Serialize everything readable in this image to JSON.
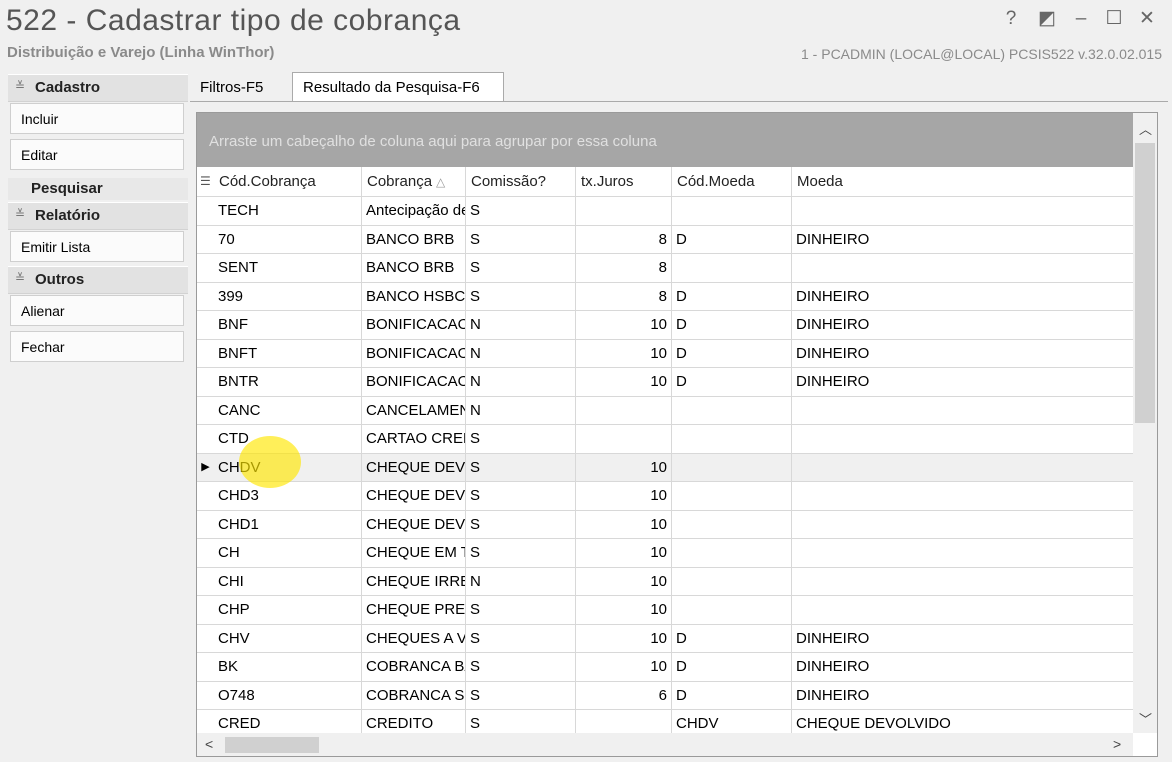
{
  "window": {
    "title": "522 - Cadastrar tipo de cobrança",
    "subtitle": "Distribuição e Varejo (Linha WinThor)",
    "session_info": "1 - PCADMIN (LOCAL@LOCAL)   PCSIS522  v.32.0.02.015",
    "controls": {
      "help": "?",
      "skin": "◩",
      "minimize": "–",
      "maximize": "☐",
      "close": "✕"
    }
  },
  "sidebar": {
    "groups": [
      {
        "label": "Cadastro",
        "items": [
          "Incluir",
          "Editar"
        ],
        "active_item": "Pesquisar"
      },
      {
        "label": "Relatório",
        "items": [
          "Emitir Lista"
        ]
      },
      {
        "label": "Outros",
        "items": [
          "Alienar",
          "Fechar"
        ]
      }
    ],
    "chevron_icon": "double-chevron-down-icon"
  },
  "tabs": [
    {
      "label": "Filtros-F5",
      "active": false
    },
    {
      "label": "Resultado da Pesquisa-F6",
      "active": true
    }
  ],
  "grid": {
    "group_panel_hint": "Arraste um cabeçalho de coluna aqui para agrupar por essa coluna",
    "columns": [
      "Cód.Cobrança",
      "Cobrança",
      "Comissão?",
      "tx.Juros",
      "Cód.Moeda",
      "Moeda"
    ],
    "sort_indicator": "△",
    "rows": [
      {
        "cod": "TECH",
        "cobranca": "Antecipação de",
        "comissao": "S",
        "juros": "",
        "cod_moeda": "",
        "moeda": ""
      },
      {
        "cod": "70",
        "cobranca": "BANCO BRB",
        "comissao": "S",
        "juros": "8",
        "cod_moeda": "D",
        "moeda": "DINHEIRO"
      },
      {
        "cod": "SENT",
        "cobranca": "BANCO BRB",
        "comissao": "S",
        "juros": "8",
        "cod_moeda": "",
        "moeda": ""
      },
      {
        "cod": "399",
        "cobranca": "BANCO HSBC",
        "comissao": "S",
        "juros": "8",
        "cod_moeda": "D",
        "moeda": "DINHEIRO"
      },
      {
        "cod": "BNF",
        "cobranca": "BONIFICACAO",
        "comissao": "N",
        "juros": "10",
        "cod_moeda": "D",
        "moeda": "DINHEIRO"
      },
      {
        "cod": "BNFT",
        "cobranca": "BONIFICACAO",
        "comissao": "N",
        "juros": "10",
        "cod_moeda": "D",
        "moeda": "DINHEIRO"
      },
      {
        "cod": "BNTR",
        "cobranca": "BONIFICACAO",
        "comissao": "N",
        "juros": "10",
        "cod_moeda": "D",
        "moeda": "DINHEIRO"
      },
      {
        "cod": "CANC",
        "cobranca": "CANCELAMENTO",
        "comissao": "N",
        "juros": "",
        "cod_moeda": "",
        "moeda": ""
      },
      {
        "cod": "CTD",
        "cobranca": "CARTAO CREDITO",
        "comissao": "S",
        "juros": "",
        "cod_moeda": "",
        "moeda": ""
      },
      {
        "cod": "CHDV",
        "cobranca": "CHEQUE DEVOLVIDO",
        "comissao": "S",
        "juros": "10",
        "cod_moeda": "",
        "moeda": "",
        "selected": true
      },
      {
        "cod": "CHD3",
        "cobranca": "CHEQUE DEVOLVIDO",
        "comissao": "S",
        "juros": "10",
        "cod_moeda": "",
        "moeda": ""
      },
      {
        "cod": "CHD1",
        "cobranca": "CHEQUE DEVOLVIDO",
        "comissao": "S",
        "juros": "10",
        "cod_moeda": "",
        "moeda": ""
      },
      {
        "cod": "CH",
        "cobranca": "CHEQUE EM TERCEIROS",
        "comissao": "S",
        "juros": "10",
        "cod_moeda": "",
        "moeda": ""
      },
      {
        "cod": "CHI",
        "cobranca": "CHEQUE IRREGULAR",
        "comissao": "N",
        "juros": "10",
        "cod_moeda": "",
        "moeda": ""
      },
      {
        "cod": "CHP",
        "cobranca": "CHEQUE PRE",
        "comissao": "S",
        "juros": "10",
        "cod_moeda": "",
        "moeda": ""
      },
      {
        "cod": "CHV",
        "cobranca": "CHEQUES A VISTA",
        "comissao": "S",
        "juros": "10",
        "cod_moeda": "D",
        "moeda": "DINHEIRO"
      },
      {
        "cod": "BK",
        "cobranca": "COBRANCA BANCARIA",
        "comissao": "S",
        "juros": "10",
        "cod_moeda": "D",
        "moeda": "DINHEIRO"
      },
      {
        "cod": "O748",
        "cobranca": "COBRANCA SICREDI",
        "comissao": "S",
        "juros": "6",
        "cod_moeda": "D",
        "moeda": "DINHEIRO"
      },
      {
        "cod": "CRED",
        "cobranca": "CREDITO",
        "comissao": "S",
        "juros": "",
        "cod_moeda": "CHDV",
        "moeda": "CHEQUE DEVOLVIDO"
      }
    ]
  },
  "colors": {
    "group_panel_bg": "#a6a6a6",
    "cursor_highlight": "#ffe600",
    "selected_row_bg": "#f0f0f0"
  }
}
